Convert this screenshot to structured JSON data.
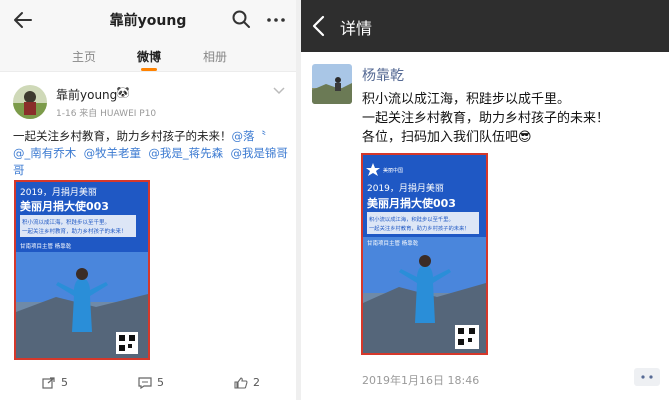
{
  "weibo": {
    "header": {
      "title": "靠前young"
    },
    "tabs": [
      {
        "label": "主页"
      },
      {
        "label": "微博"
      },
      {
        "label": "相册"
      }
    ],
    "post": {
      "author": "靠前young",
      "meta": "1-16  来自 HUAWEI P10",
      "text_line1_plain": "一起关注乡村教育，助力乡村孩子的未来！",
      "mention_1a": "@落〝",
      "mention_1b": "@_南有乔木",
      "mention_2": "@牧羊老童",
      "mention_3": "@我是_蒋先森",
      "mention_4": "@我是锦哥哥"
    },
    "actions": {
      "repost_count": "5",
      "comment_count": "5",
      "like_count": "2"
    }
  },
  "poster": {
    "headline_1": "2019，月捐月美丽",
    "headline_2": "美丽月捐大使003",
    "quote_1": "积小流以成江海，积跬步以至千里。",
    "quote_2": "一起关注乡村教育，助力乡村孩子的未来！",
    "tag": "甘南项目主管 杨靠乾",
    "logo_text": "美丽中国"
  },
  "wechat": {
    "header": {
      "title": "详情"
    },
    "post": {
      "author": "杨靠乾",
      "line1": "积小流以成江海，积跬步以成千里。",
      "line2": "一起关注乡村教育，助力乡村孩子的未来！",
      "line3": "各位，扫码加入我们队伍吧😎",
      "time": "2019年1月16日 18:46"
    }
  },
  "colors": {
    "weibo_accent": "#ff8200",
    "mention": "#3b7ad1",
    "wechat_name": "#576b95",
    "wechat_header": "#2e2e2e",
    "poster_border": "#d5382b",
    "poster_bg": "#1f58c4"
  }
}
